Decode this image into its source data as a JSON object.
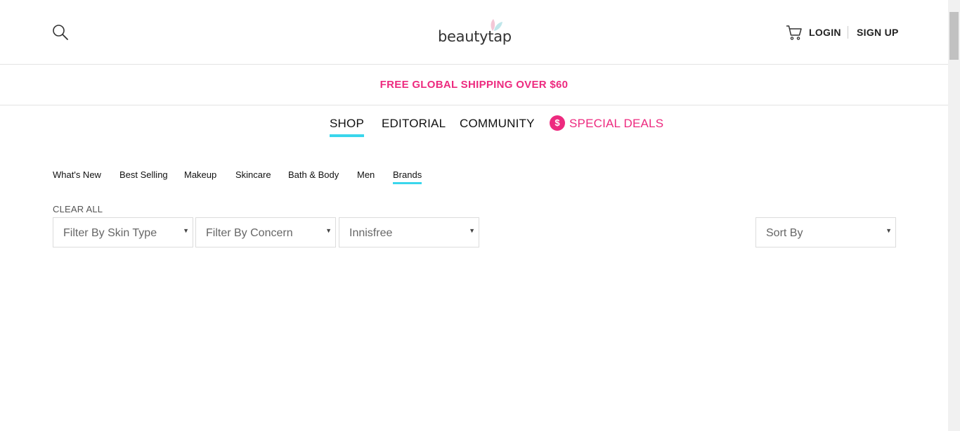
{
  "header": {
    "logo_text": "beautytap",
    "login_label": "LOGIN",
    "signup_label": "SIGN UP",
    "icons": [
      "search-icon",
      "cart-icon",
      "logo-leaf-icon"
    ]
  },
  "promo": {
    "text": "FREE GLOBAL SHIPPING OVER $60",
    "color": "#ed2a7f"
  },
  "main_nav": {
    "items": [
      "SHOP",
      "EDITORIAL",
      "COMMUNITY"
    ],
    "active": "SHOP",
    "deals_symbol": "$",
    "deals_label": "SPECIAL DEALS",
    "accent": "#3ad6ec"
  },
  "sub_nav": {
    "items": [
      "What's New",
      "Best Selling",
      "Makeup",
      "Skincare",
      "Bath & Body",
      "Men",
      "Brands"
    ],
    "active": "Brands"
  },
  "filters": {
    "clear_all": "CLEAR ALL",
    "skin_type": "Filter By Skin Type",
    "concern": "Filter By Concern",
    "brand": "Innisfree",
    "sort": "Sort By",
    "caret": "▼"
  }
}
